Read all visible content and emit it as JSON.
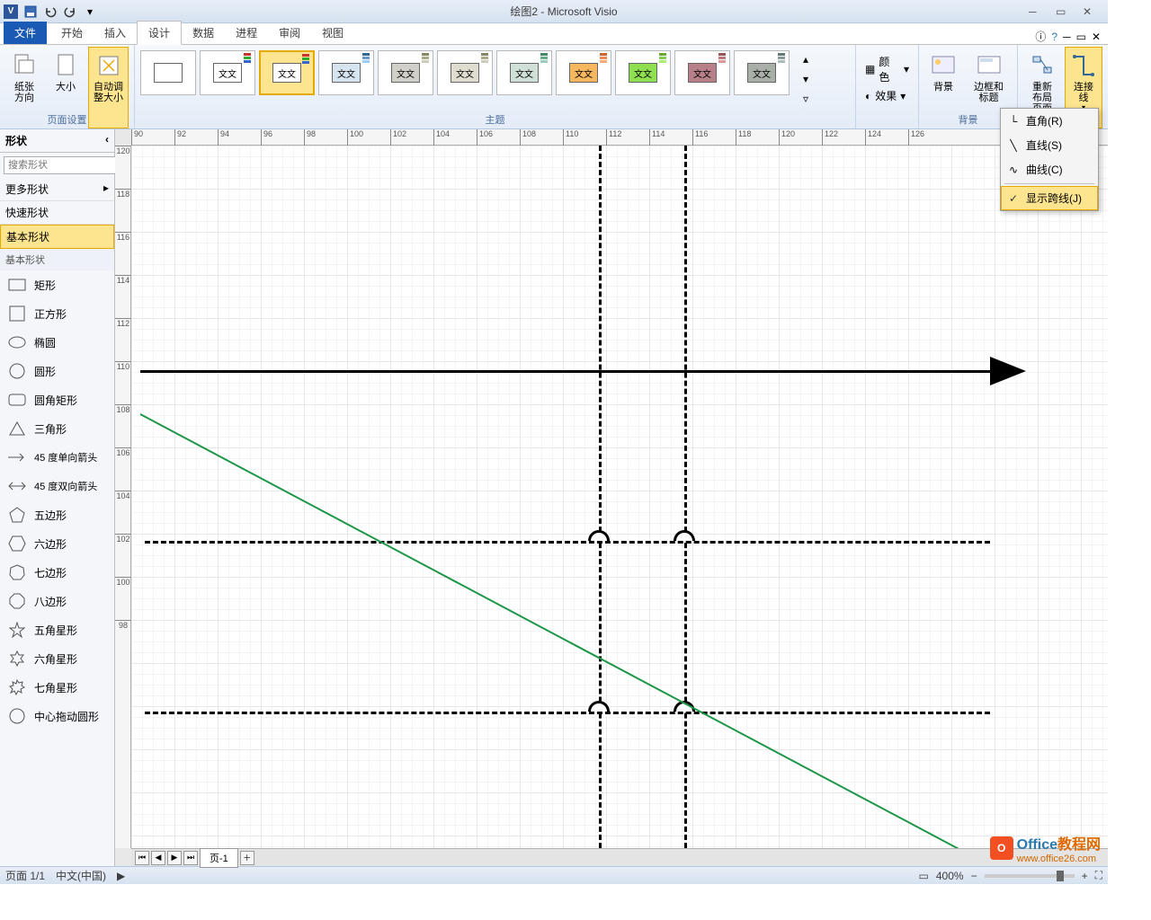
{
  "title": "绘图2 - Microsoft Visio",
  "app_letter": "V",
  "tabs": {
    "file": "文件",
    "items": [
      "开始",
      "插入",
      "设计",
      "数据",
      "进程",
      "审阅",
      "视图"
    ],
    "active": "设计"
  },
  "ribbon": {
    "page_setup": {
      "label": "页面设置",
      "orientation": "纸张方向",
      "size": "大小",
      "autosize": "自动调整大小"
    },
    "theme": {
      "label": "主题",
      "sample_text": "文文"
    },
    "theme_opts": {
      "color": "颜色",
      "effects": "效果"
    },
    "background": {
      "label": "背景",
      "bg": "背景",
      "border_title": "边框和标题"
    },
    "layout": {
      "relayout": "重新布局页面",
      "connector": "连接线"
    }
  },
  "dropdown": {
    "right_angle": "直角(R)",
    "straight": "直线(S)",
    "curve": "曲线(C)",
    "show_jumps": "显示跨线(J)"
  },
  "shapes_panel": {
    "title": "形状",
    "search_placeholder": "搜索形状",
    "more_shapes": "更多形状",
    "quick_shapes": "快速形状",
    "basic_shapes": "基本形状",
    "basic_shapes_header": "基本形状",
    "shapes": [
      "矩形",
      "正方形",
      "椭圆",
      "圆形",
      "圆角矩形",
      "三角形",
      "45 度单向箭头",
      "45 度双向箭头",
      "五边形",
      "六边形",
      "七边形",
      "八边形",
      "五角星形",
      "六角星形",
      "七角星形",
      "中心拖动圆形"
    ]
  },
  "ruler_h": [
    "90",
    "92",
    "94",
    "96",
    "98",
    "100",
    "102",
    "104",
    "106",
    "108",
    "110",
    "112",
    "114",
    "116",
    "118",
    "120",
    "122",
    "124",
    "126"
  ],
  "ruler_v": [
    "120",
    "118",
    "116",
    "114",
    "112",
    "110",
    "108",
    "106",
    "104",
    "102",
    "100",
    "98"
  ],
  "page_tab": "页-1",
  "status": {
    "page": "页面 1/1",
    "lang": "中文(中国)",
    "zoom": "400%"
  },
  "watermark": {
    "text1": "Office",
    "text2": "教程网",
    "url": "www.office26.com"
  }
}
